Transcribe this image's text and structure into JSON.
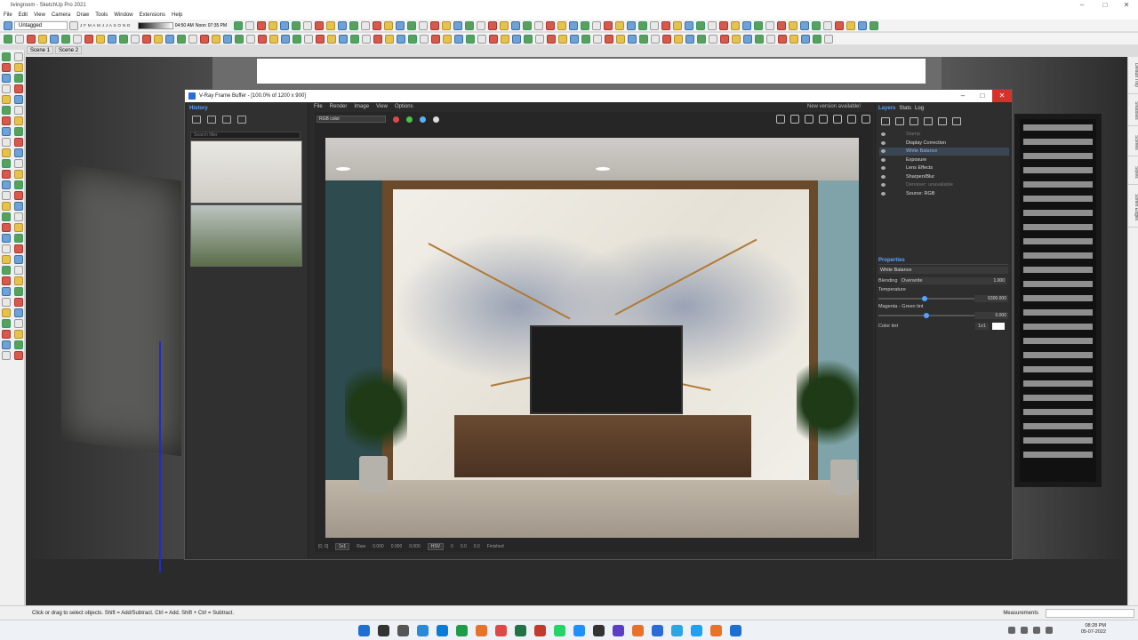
{
  "app": {
    "title": "livingroom - SketchUp Pro 2021",
    "menu": [
      "File",
      "Edit",
      "View",
      "Camera",
      "Draw",
      "Tools",
      "Window",
      "Extensions",
      "Help"
    ],
    "layer_tag": "Untagged",
    "months": "J F M A M J J A S O N D",
    "time_start": "04:50 AM",
    "time_noon": "Noon",
    "time_end": "07:35 PM",
    "scenes": [
      "Scene 1",
      "Scene 2"
    ],
    "right_tabs": [
      "Default Tray",
      "Shadows",
      "Scenes",
      "Styles",
      "Soften Edges"
    ]
  },
  "vfb": {
    "title": "V-Ray Frame Buffer - [100.0% of 1200 x 900]",
    "menu": [
      "File",
      "Render",
      "Image",
      "View",
      "Options"
    ],
    "new_version": "New version available!",
    "history": {
      "label": "History",
      "search_placeholder": "Search filter"
    },
    "channel": "RGB color",
    "status": {
      "coords": "[0, 0]",
      "zoom": "1x1",
      "mode": "Raw",
      "r": "0.000",
      "g": "0.000",
      "b": "0.000",
      "space": "HSV",
      "h": "0",
      "s": "0.0",
      "v": "0.0",
      "state": "Finished"
    },
    "layers_tabs": [
      "Layers",
      "Stats",
      "Log"
    ],
    "layers": [
      {
        "name": "Stamp",
        "state": "dim"
      },
      {
        "name": "Display Correction",
        "state": "normal"
      },
      {
        "name": "White Balance",
        "state": "sel"
      },
      {
        "name": "Exposure",
        "state": "normal"
      },
      {
        "name": "Lens Effects",
        "state": "normal"
      },
      {
        "name": "Sharpen/Blur",
        "state": "normal"
      },
      {
        "name": "Denoiser: unavailable",
        "state": "dim"
      },
      {
        "name": "Source: RGB",
        "state": "normal"
      }
    ],
    "properties": {
      "header": "Properties",
      "layer": "White Balance",
      "blending_label": "Blending",
      "blending_mode": "Overwrite",
      "blending_value": "1.000",
      "temperature_label": "Temperature",
      "temperature_value": "6300.000",
      "temperature_level": 0.48,
      "tint_label": "Magenta - Green tint",
      "tint_value": "0.000",
      "tint_level": 0.5,
      "color_tint_label": "Color tint",
      "color_tint_mode": "1x1"
    }
  },
  "status": {
    "hint": "Click or drag to select objects. Shift = Add/Subtract. Ctrl = Add. Shift + Ctrl = Subtract.",
    "measurements": "Measurements"
  },
  "taskbar": {
    "time": "08:28 PM",
    "date": "05-07-2022"
  },
  "colors": {
    "accent": "#5aa2ff",
    "close_red": "#d7322a",
    "red_dot": "#e04848",
    "green_dot": "#4ac24a",
    "blue_dot": "#5ab0ff"
  }
}
